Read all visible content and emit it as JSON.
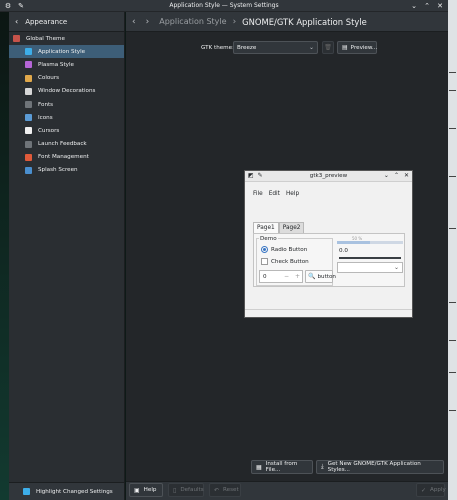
{
  "window": {
    "title": "Application Style — System Settings"
  },
  "sidebar": {
    "header": "Appearance",
    "items": [
      {
        "label": "Global Theme",
        "icon": "global-theme-icon",
        "color": "#c7534a",
        "sub": false,
        "selected": false
      },
      {
        "label": "Application Style",
        "icon": "brush-icon",
        "color": "#3daee9",
        "sub": true,
        "selected": true
      },
      {
        "label": "Plasma Style",
        "icon": "plasma-icon",
        "color": "#b565d6",
        "sub": true,
        "selected": false
      },
      {
        "label": "Colours",
        "icon": "colour-wheel-icon",
        "color": "#e0a84b",
        "sub": true,
        "selected": false
      },
      {
        "label": "Window Decorations",
        "icon": "window-icon",
        "color": "#d7d7d7",
        "sub": true,
        "selected": false
      },
      {
        "label": "Fonts",
        "icon": "font-icon",
        "color": "#6f7479",
        "sub": true,
        "selected": false
      },
      {
        "label": "Icons",
        "icon": "icons-icon",
        "color": "#5b9bd5",
        "sub": true,
        "selected": false
      },
      {
        "label": "Cursors",
        "icon": "cursor-icon",
        "color": "#f0f0f0",
        "sub": true,
        "selected": false
      },
      {
        "label": "Launch Feedback",
        "icon": "launch-feedback-icon",
        "color": "#6f7479",
        "sub": true,
        "selected": false
      },
      {
        "label": "Font Management",
        "icon": "font-management-icon",
        "color": "#e05a3a",
        "sub": true,
        "selected": false
      },
      {
        "label": "Splash Screen",
        "icon": "splash-icon",
        "color": "#4a8fcf",
        "sub": true,
        "selected": false
      }
    ],
    "footer": "Highlight Changed Settings"
  },
  "header": {
    "breadcrumb_parent": "Application Style",
    "breadcrumb_current": "GNOME/GTK Application Style"
  },
  "gtk_theme": {
    "label": "GTK theme:",
    "value": "Breeze",
    "preview_label": "Preview..."
  },
  "actions": {
    "install_label": "Install from File...",
    "get_new_label": "Get New GNOME/GTK Application Styles..."
  },
  "footer": {
    "help": "Help",
    "defaults": "Defaults",
    "reset": "Reset",
    "apply": "Apply"
  },
  "gtk_preview": {
    "title": "gtk3_preview",
    "menu": [
      "File",
      "Edit",
      "Help"
    ],
    "tabs": [
      "Page1",
      "Page2"
    ],
    "frame_label": "Demo",
    "radio_label": "Radio Button",
    "check_label": "Check Button",
    "spin_value": "0",
    "button_label": "button",
    "progress_label": "50 %",
    "progress_fraction": 0.5,
    "scale_value": "0.0"
  }
}
